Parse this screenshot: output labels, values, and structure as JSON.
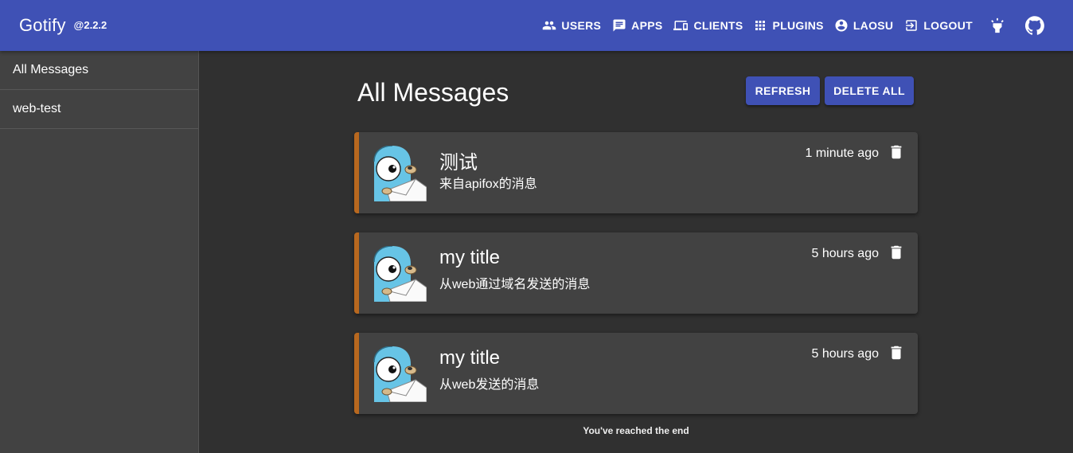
{
  "app": {
    "name": "Gotify",
    "version": "@2.2.2"
  },
  "nav": {
    "users": "USERS",
    "apps": "APPS",
    "clients": "CLIENTS",
    "plugins": "PLUGINS",
    "user": "LAOSU",
    "logout": "LOGOUT",
    "theme_icon": "lightbulb-icon",
    "github_icon": "github-icon"
  },
  "sidebar": {
    "items": [
      {
        "label": "All Messages"
      },
      {
        "label": "web-test"
      }
    ]
  },
  "page": {
    "title": "All Messages",
    "refresh_label": "REFRESH",
    "delete_all_label": "DELETE ALL"
  },
  "messages": [
    {
      "title": "测试",
      "body": "来自apifox的消息",
      "date": "1 minute ago"
    },
    {
      "title": "my title",
      "body": "从web通过域名发送的消息",
      "date": "5 hours ago"
    },
    {
      "title": "my title",
      "body": "从web发送的消息",
      "date": "5 hours ago"
    }
  ],
  "footer": {
    "end_text": "You've reached the end"
  },
  "colors": {
    "appbar": "#3f51b5",
    "background": "#303030",
    "paper": "#424242",
    "accent": "#b8681f"
  }
}
